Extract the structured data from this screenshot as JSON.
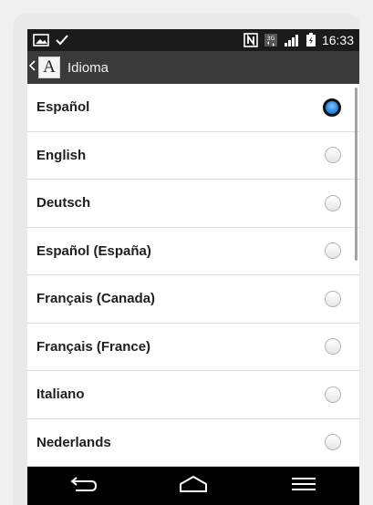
{
  "status_bar": {
    "time": "16:33",
    "left_icons": [
      "image-icon",
      "check-icon"
    ],
    "right_icons": [
      "nfc-icon",
      "3g-data-icon",
      "signal-icon",
      "battery-icon"
    ]
  },
  "action_bar": {
    "back_icon": "chevron-left-icon",
    "app_icon_letter": "A",
    "title": "Idioma"
  },
  "languages": [
    {
      "label": "Español",
      "selected": true
    },
    {
      "label": "English",
      "selected": false
    },
    {
      "label": "Deutsch",
      "selected": false
    },
    {
      "label": "Español (España)",
      "selected": false
    },
    {
      "label": "Français (Canada)",
      "selected": false
    },
    {
      "label": "Français (France)",
      "selected": false
    },
    {
      "label": "Italiano",
      "selected": false
    },
    {
      "label": "Nederlands",
      "selected": false
    }
  ],
  "nav_bar": {
    "buttons": [
      "back-icon",
      "home-icon",
      "menu-icon"
    ]
  },
  "colors": {
    "status_bar": "#1b1b1b",
    "action_bar": "#3a3a3a",
    "radio_selected": "#2e8ae6",
    "nav_bar": "#000000"
  }
}
